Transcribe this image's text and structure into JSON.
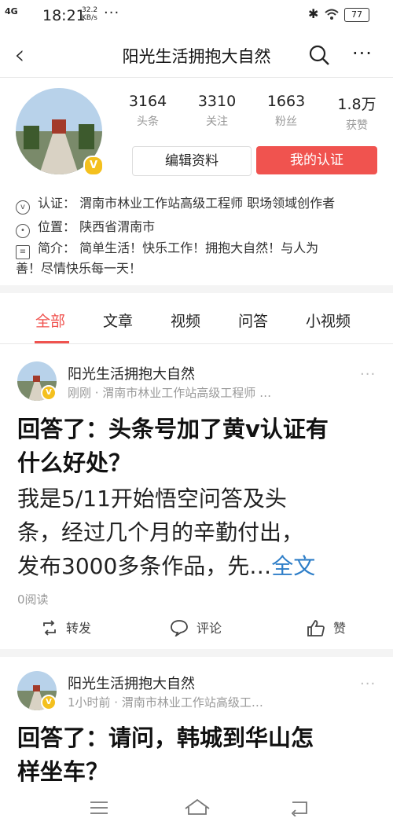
{
  "status": {
    "network": "4G",
    "time": "18:21",
    "speed": "32.2",
    "speed_unit": "KB/s",
    "dots": "···",
    "battery": "77"
  },
  "nav": {
    "title": "阳光生活拥抱大自然"
  },
  "profile": {
    "stats": [
      {
        "num": "3164",
        "label": "头条"
      },
      {
        "num": "3310",
        "label": "关注"
      },
      {
        "num": "1663",
        "label": "粉丝"
      },
      {
        "num": "1.8万",
        "label": "获赞"
      }
    ],
    "edit_label": "编辑资料",
    "verify_label": "我的认证",
    "cert": "认证： 渭南市林业工作站高级工程师 职场领域创作者",
    "location": "位置： 陕西省渭南市",
    "bio_line1": "简介： 简单生活！快乐工作！拥抱大自然！与人为",
    "bio_line2": "善！尽情快乐每一天！",
    "badge": "V"
  },
  "tabs": [
    "全部",
    "文章",
    "视频",
    "问答",
    "小视频"
  ],
  "posts": [
    {
      "author": "阳光生活拥抱大自然",
      "meta": "刚刚 · 渭南市林业工作站高级工程师 …",
      "title1": "回答了：头条号加了黄v认证有",
      "title2": "什么好处？",
      "body1": "我是5/11开始悟空问答及头",
      "body2": "条，经过几个月的辛勤付出，",
      "body3": "发布3000多条作品，先…",
      "full": "全文",
      "reads": "0阅读",
      "share": "转发",
      "comment": "评论",
      "like": "赞"
    },
    {
      "author": "阳光生活拥抱大自然",
      "meta": "1小时前 · 渭南市林业工作站高级工…",
      "title1": "回答了：请问，韩城到华山怎",
      "title2": "样坐车？"
    }
  ]
}
